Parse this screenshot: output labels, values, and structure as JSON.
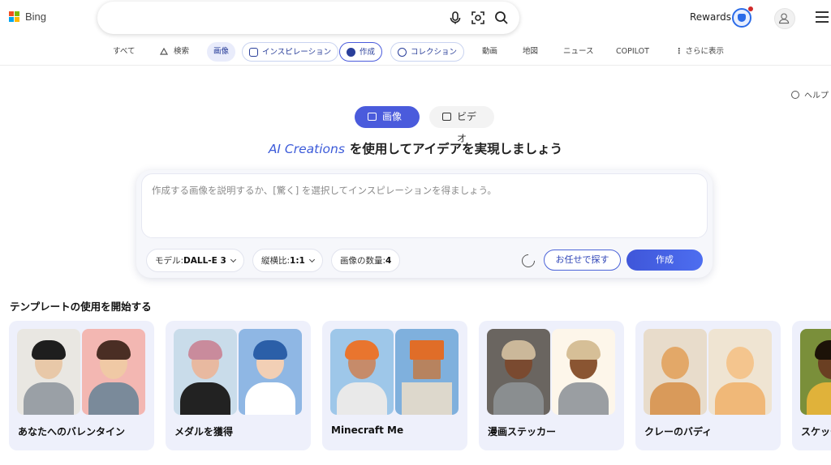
{
  "brand": {
    "logo_text": "Bing",
    "colors": [
      "#f25022",
      "#7fba00",
      "#00a4ef",
      "#ffb900"
    ]
  },
  "search": {
    "value": "",
    "placeholder": "",
    "icons": [
      "microphone-icon",
      "visual-search-icon",
      "search-icon"
    ]
  },
  "header": {
    "rewards_label": "Rewards",
    "rewards_icon": "rewards-trophy-icon",
    "avatar_icon": "user-icon",
    "menu_icon": "hamburger-icon"
  },
  "nav": {
    "all": "すべて",
    "search": "検索",
    "images": "画像",
    "inspiration": "インスピレーション",
    "create": "作成",
    "collections": "コレクション",
    "videos": "動画",
    "maps": "地図",
    "news": "ニュース",
    "copilot": "COPILOT",
    "more": "さらに表示"
  },
  "help_label": "ヘルプ",
  "mode_toggle": {
    "image": "画像",
    "video": "ビデオ",
    "active": "image"
  },
  "headline": {
    "accent": "AI Creations",
    "rest": "を使用してアイデアを実現しましょう"
  },
  "composer": {
    "placeholder": "作成する画像を説明するか、[驚く] を選択してインスピレーションを得ましょう。",
    "value": "",
    "model_label": "モデル:",
    "model_value": "DALL-E 3",
    "ratio_label": "縦横比:",
    "ratio_value": "1:1",
    "count_label": "画像の数量:",
    "count_value": "4",
    "surprise_label": "お任せで探す",
    "create_label": "作成"
  },
  "templates": {
    "title": "テンプレートの使用を開始する",
    "cards": [
      {
        "label": "あなたへのバレンタイン"
      },
      {
        "label": "メダルを獲得"
      },
      {
        "label": "Minecraft Me"
      },
      {
        "label": "漫画ステッカー"
      },
      {
        "label": "クレーのバディ"
      },
      {
        "label": "スケッチ"
      }
    ]
  },
  "accent_color": "#4a5bdc"
}
